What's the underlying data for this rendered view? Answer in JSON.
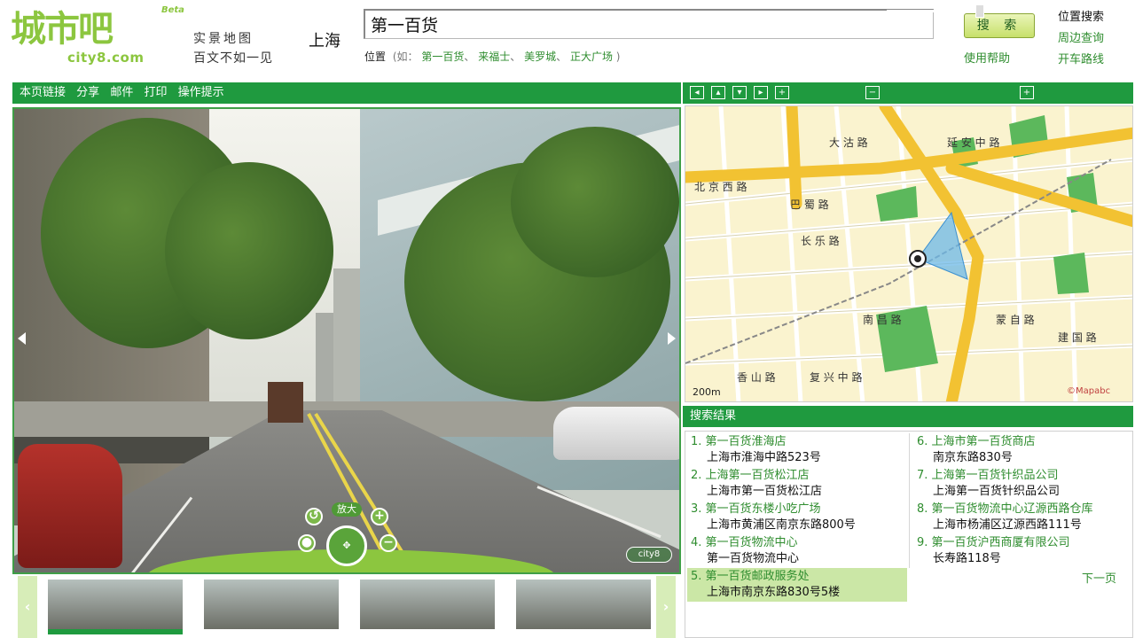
{
  "header": {
    "logo_cn": "城市吧",
    "logo_en": "city8.com",
    "logo_badge": "Beta",
    "slogan_line1": "实景地图",
    "slogan_line2": "百文不如一见",
    "city": "上海",
    "search_value": "第一百货",
    "position_label": "位置",
    "position_example": "(如：",
    "position_examples": [
      "第一百货",
      "来福士",
      "美罗城",
      "正大广场"
    ],
    "position_example_end": ")",
    "search_button": "搜 索",
    "help_link": "使用帮助",
    "side_title": "位置搜索",
    "side_links": [
      "周边查询",
      "开车路线"
    ]
  },
  "viewer_toolbar": [
    "本页链接",
    "分享",
    "邮件",
    "打印",
    "操作提示"
  ],
  "viewer": {
    "zoom_label": "放大",
    "watermark": "city8"
  },
  "map": {
    "scale": "200m",
    "copyright": "©Mapabc",
    "road_labels": [
      "大 沽 路",
      "北 京 西 路",
      "巴 蜀 路",
      "长 乐 路",
      "南 昌 路",
      "复 兴 中 路",
      "香 山 路",
      "延 安 中 路",
      "蒙 自 路",
      "建 国 路"
    ]
  },
  "results_header": "搜索结果",
  "results": [
    {
      "title": "1. 第一百货淮海店",
      "addr": "上海市淮海中路523号"
    },
    {
      "title": "2. 上海第一百货松江店",
      "addr": "上海市第一百货松江店"
    },
    {
      "title": "3. 第一百货东楼小吃广场",
      "addr": "上海市黄浦区南京东路800号"
    },
    {
      "title": "4. 第一百货物流中心",
      "addr": "第一百货物流中心"
    },
    {
      "title": "5. 第一百货邮政服务处",
      "addr": "上海市南京东路830号5楼"
    },
    {
      "title": "6. 上海市第一百货商店",
      "addr": "南京东路830号"
    },
    {
      "title": "7. 上海第一百货针织品公司",
      "addr": "上海第一百货针织品公司"
    },
    {
      "title": "8. 第一百货物流中心辽源西路仓库",
      "addr": "上海市杨浦区辽源西路111号"
    },
    {
      "title": "9. 第一百货沪西商厦有限公司",
      "addr": "长寿路118号"
    }
  ],
  "highlighted_result": 5,
  "next_page": "下一页",
  "colors": {
    "brand_green": "#1f9a3f",
    "logo_green": "#8cc63f",
    "link_green": "#2f8d2f",
    "highlight": "#cbe7a6"
  }
}
